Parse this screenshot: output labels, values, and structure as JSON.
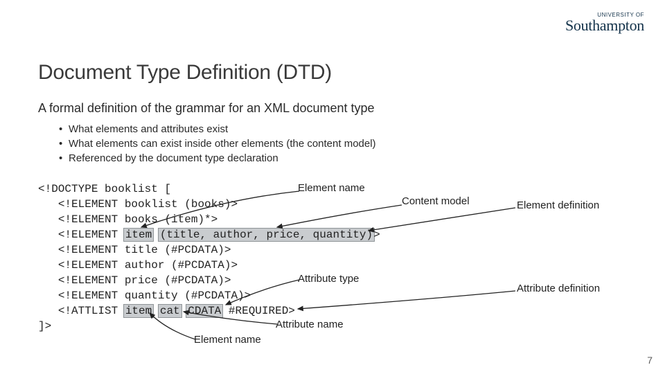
{
  "logo": {
    "tagline": "UNIVERSITY OF",
    "name": "Southampton"
  },
  "title": "Document Type Definition (DTD)",
  "subtitle": "A formal definition of the grammar for an XML document type",
  "bullets": [
    "What elements and attributes exist",
    "What elements can exist inside other elements (the content model)",
    "Referenced by the document type declaration"
  ],
  "code": {
    "l0": "<!DOCTYPE booklist [",
    "l1a": "<!ELEMENT booklist (books)>",
    "l2a": "<!ELEMENT books (item)*>",
    "l3a": "<!ELEMENT ",
    "l3b": "item",
    "l3c": " ",
    "l3d": "(title, author, price, quantity)",
    "l3e": ">",
    "l4a": "<!ELEMENT title (#PCDATA)>",
    "l5a": "<!ELEMENT author (#PCDATA)>",
    "l6a": "<!ELEMENT price (#PCDATA)>",
    "l7a": "<!ELEMENT quantity (#PCDATA)>",
    "l8a": "<!ATTLIST ",
    "l8b": "item",
    "l8c": " ",
    "l8d": "cat",
    "l8e": " ",
    "l8f": "CDATA",
    "l8g": " #REQUIRED>",
    "l9": "]>"
  },
  "labels": {
    "element_name_top": "Element name",
    "content_model": "Content model",
    "element_definition": "Element definition",
    "attribute_type": "Attribute type",
    "attribute_definition": "Attribute definition",
    "attribute_name": "Attribute name",
    "element_name_bottom": "Element name"
  },
  "page": "7"
}
